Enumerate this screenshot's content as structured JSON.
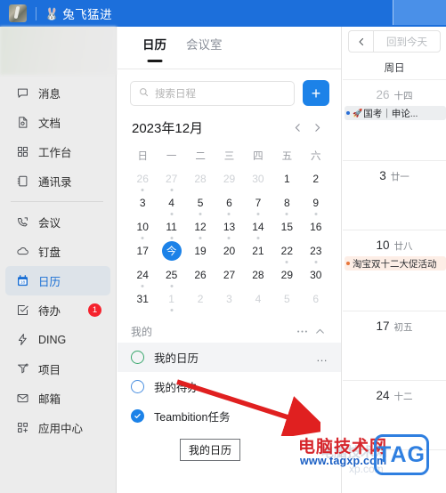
{
  "topbar": {
    "app_icon": "user-avatar",
    "rabbit_emoji": "🐰",
    "title": "兔飞猛进",
    "history_icon": "history-icon"
  },
  "sidebar": {
    "items": [
      {
        "icon": "message-icon",
        "label": "消息",
        "active": false,
        "badge": ""
      },
      {
        "icon": "document-icon",
        "label": "文档",
        "active": false,
        "badge": ""
      },
      {
        "icon": "workbench-icon",
        "label": "工作台",
        "active": false,
        "badge": ""
      },
      {
        "icon": "contacts-icon",
        "label": "通讯录",
        "active": false,
        "badge": ""
      },
      {
        "icon": "meeting-icon",
        "label": "会议",
        "active": false,
        "badge": ""
      },
      {
        "icon": "cloud-icon",
        "label": "钉盘",
        "active": false,
        "badge": ""
      },
      {
        "icon": "calendar-icon",
        "label": "日历",
        "active": true,
        "badge": ""
      },
      {
        "icon": "todo-icon",
        "label": "待办",
        "active": false,
        "badge": "1"
      },
      {
        "icon": "ding-icon",
        "label": "DING",
        "active": false,
        "badge": ""
      },
      {
        "icon": "project-icon",
        "label": "项目",
        "active": false,
        "badge": ""
      },
      {
        "icon": "mail-icon",
        "label": "邮箱",
        "active": false,
        "badge": ""
      },
      {
        "icon": "appcenter-icon",
        "label": "应用中心",
        "active": false,
        "badge": ""
      }
    ],
    "separator_after_index": 3
  },
  "midpanel": {
    "tabs": [
      {
        "label": "日历",
        "active": true
      },
      {
        "label": "会议室",
        "active": false
      }
    ],
    "search": {
      "placeholder": "搜索日程",
      "value": "",
      "icon": "search-icon"
    },
    "add_button": {
      "label": "+",
      "icon": "plus-icon"
    },
    "month_label": "2023年12月",
    "prev_icon": "chevron-left-icon",
    "next_icon": "chevron-right-icon",
    "weekdays": [
      "日",
      "一",
      "二",
      "三",
      "四",
      "五",
      "六"
    ],
    "today_badge_label": "今",
    "days": [
      {
        "d": "26",
        "out": true,
        "dot": true
      },
      {
        "d": "27",
        "out": true,
        "dot": true
      },
      {
        "d": "28",
        "out": true,
        "dot": false
      },
      {
        "d": "29",
        "out": true,
        "dot": false
      },
      {
        "d": "30",
        "out": true,
        "dot": false
      },
      {
        "d": "1",
        "out": false,
        "dot": false
      },
      {
        "d": "2",
        "out": false,
        "dot": false
      },
      {
        "d": "3",
        "out": false,
        "dot": false
      },
      {
        "d": "4",
        "out": false,
        "dot": true
      },
      {
        "d": "5",
        "out": false,
        "dot": true
      },
      {
        "d": "6",
        "out": false,
        "dot": true
      },
      {
        "d": "7",
        "out": false,
        "dot": true
      },
      {
        "d": "8",
        "out": false,
        "dot": true
      },
      {
        "d": "9",
        "out": false,
        "dot": true
      },
      {
        "d": "10",
        "out": false,
        "dot": true
      },
      {
        "d": "11",
        "out": false,
        "dot": true
      },
      {
        "d": "12",
        "out": false,
        "dot": true
      },
      {
        "d": "13",
        "out": false,
        "dot": true
      },
      {
        "d": "14",
        "out": false,
        "dot": true
      },
      {
        "d": "15",
        "out": false,
        "dot": false
      },
      {
        "d": "16",
        "out": false,
        "dot": false
      },
      {
        "d": "17",
        "out": false,
        "dot": false
      },
      {
        "d": "18",
        "out": false,
        "dot": false,
        "today": true
      },
      {
        "d": "19",
        "out": false,
        "dot": false
      },
      {
        "d": "20",
        "out": false,
        "dot": false
      },
      {
        "d": "21",
        "out": false,
        "dot": false
      },
      {
        "d": "22",
        "out": false,
        "dot": true
      },
      {
        "d": "23",
        "out": false,
        "dot": true
      },
      {
        "d": "24",
        "out": false,
        "dot": true
      },
      {
        "d": "25",
        "out": false,
        "dot": true
      },
      {
        "d": "26",
        "out": false,
        "dot": false
      },
      {
        "d": "27",
        "out": false,
        "dot": false
      },
      {
        "d": "28",
        "out": false,
        "dot": false
      },
      {
        "d": "29",
        "out": false,
        "dot": false
      },
      {
        "d": "30",
        "out": false,
        "dot": false
      },
      {
        "d": "31",
        "out": false,
        "dot": false
      },
      {
        "d": "1",
        "out": true,
        "dot": true
      },
      {
        "d": "2",
        "out": true,
        "dot": false
      },
      {
        "d": "3",
        "out": true,
        "dot": false
      },
      {
        "d": "4",
        "out": true,
        "dot": false
      },
      {
        "d": "5",
        "out": true,
        "dot": false
      },
      {
        "d": "6",
        "out": true,
        "dot": false
      }
    ],
    "my_section": {
      "title": "我的",
      "more_icon": "ellipsis-icon",
      "collapse_icon": "chevron-up-icon",
      "calendars": [
        {
          "label": "我的日历",
          "circle": "green",
          "checked": false,
          "hovered": true,
          "more": "…"
        },
        {
          "label": "我的待办",
          "circle": "blue",
          "checked": false,
          "hovered": false,
          "more": ""
        },
        {
          "label": "Teambition任务",
          "circle": "checked",
          "checked": true,
          "hovered": false,
          "more": ""
        }
      ]
    },
    "tooltip": "我的日历"
  },
  "rightpanel": {
    "back_icon": "chevron-left-icon",
    "back_to_today_label": "回到今天",
    "weekday_header": "周日",
    "weeks": [
      {
        "num": "26",
        "lunar": "十四",
        "out": true,
        "events": [
          {
            "title": "国考｜申论...",
            "emoji": "🚀",
            "dot": "blue",
            "style": "gray"
          }
        ]
      },
      {
        "num": "3",
        "lunar": "廿一",
        "out": false,
        "events": []
      },
      {
        "num": "10",
        "lunar": "廿八",
        "out": false,
        "events": [
          {
            "title": "淘宝双十二大促活动",
            "emoji": "",
            "dot": "orange",
            "style": "peach"
          }
        ]
      },
      {
        "num": "17",
        "lunar": "初五",
        "out": false,
        "events": []
      },
      {
        "num": "24",
        "lunar": "十二",
        "out": false,
        "events": []
      }
    ]
  },
  "watermark": {
    "brand_cn": "电脑技术网",
    "url": "www.tagxp.com",
    "tag": "TAG",
    "ghost_cn": "电脑技术网",
    "ghost_url": "xp.com"
  }
}
